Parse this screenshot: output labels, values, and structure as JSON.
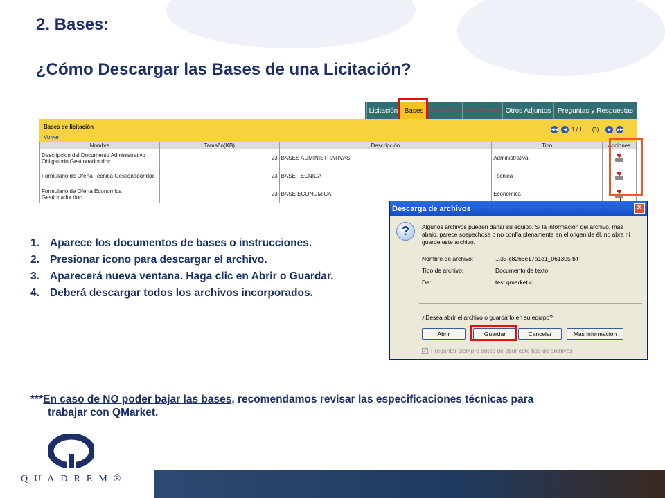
{
  "slide": {
    "title": "2. Bases:",
    "subtitle": "¿Cómo Descargar las Bases de una Licitación?"
  },
  "portal": {
    "tabs": [
      {
        "label": "Licitación"
      },
      {
        "label": "Bases"
      },
      {
        "label": "Consulta Técnica"
      },
      {
        "label": "Consulta Económica"
      },
      {
        "label": "Otros Adjuntos"
      },
      {
        "label": "Preguntas y Respuestas"
      }
    ],
    "section_title": "Bases de licitación",
    "back_link": "Volver",
    "pager": {
      "page": "1 / 1",
      "count": "(3)"
    },
    "columns": [
      "Nombre",
      "Tamaño(KB)",
      "Descripción",
      "Tipo",
      "Acciones"
    ],
    "rows": [
      {
        "nombre": "Descripcion del Documento Administrativo Obligatorio Gestionador.doc",
        "size": "23",
        "descripcion": "BASES ADMINISTRATIVAS",
        "tipo": "Administrativa"
      },
      {
        "nombre": "Formulario de Oferta Tecnica Gestionador.doc",
        "size": "23",
        "descripcion": "BASE TECNICA",
        "tipo": "Técnica"
      },
      {
        "nombre": "Formulario de Oferta Economica Gestionador.doc",
        "size": "23",
        "descripcion": "BASE ECONOMICA",
        "tipo": "Económica"
      }
    ]
  },
  "steps": [
    {
      "n": "1.",
      "text": "Aparece los documentos de bases o instrucciones."
    },
    {
      "n": "2.",
      "text": "Presionar icono para descargar el archivo."
    },
    {
      "n": "3.",
      "text": "Aparecerá nueva ventana. Haga clic en Abrir o Guardar."
    },
    {
      "n": "4.",
      "text": "Deberá descargar todos los archivos incorporados."
    }
  ],
  "dialog": {
    "title": "Descarga de archivos",
    "close": "✕",
    "message": "Algunos archivos pueden dañar su equipo. Si la información del archivo, más abajo, parece sospechosa o no confía plenamente en el origen de él, no abra ni guarde este archivo.",
    "fields": [
      {
        "label": "Nombre de archivo:",
        "value": "...33-c8266e17a1e1_061305.txt"
      },
      {
        "label": "Tipo de archivo:",
        "value": "Documento de texto"
      },
      {
        "label": "De:",
        "value": "test.qmarket.cl"
      }
    ],
    "question": "¿Desea abrir el archivo o guardarlo en su equipo?",
    "buttons": {
      "open": "Abrir",
      "save": "Guardar",
      "cancel": "Cancelar",
      "more": "Más información"
    },
    "checkbox": "Preguntar siempre antes de abrir este tipo de archivos"
  },
  "note": {
    "prefix": "***",
    "link": "En caso de NO poder bajar las bases",
    "rest": ", recomendamos revisar las especificaciones técnicas para",
    "line2": "trabajar con QMarket."
  },
  "logo": {
    "word": "QUADREM®"
  },
  "colors": {
    "title": "#1c2f66",
    "tab_bar": "#2f6e73",
    "table_header": "#f5d23e",
    "highlight": "#e01010",
    "band": "#1f3a60"
  }
}
